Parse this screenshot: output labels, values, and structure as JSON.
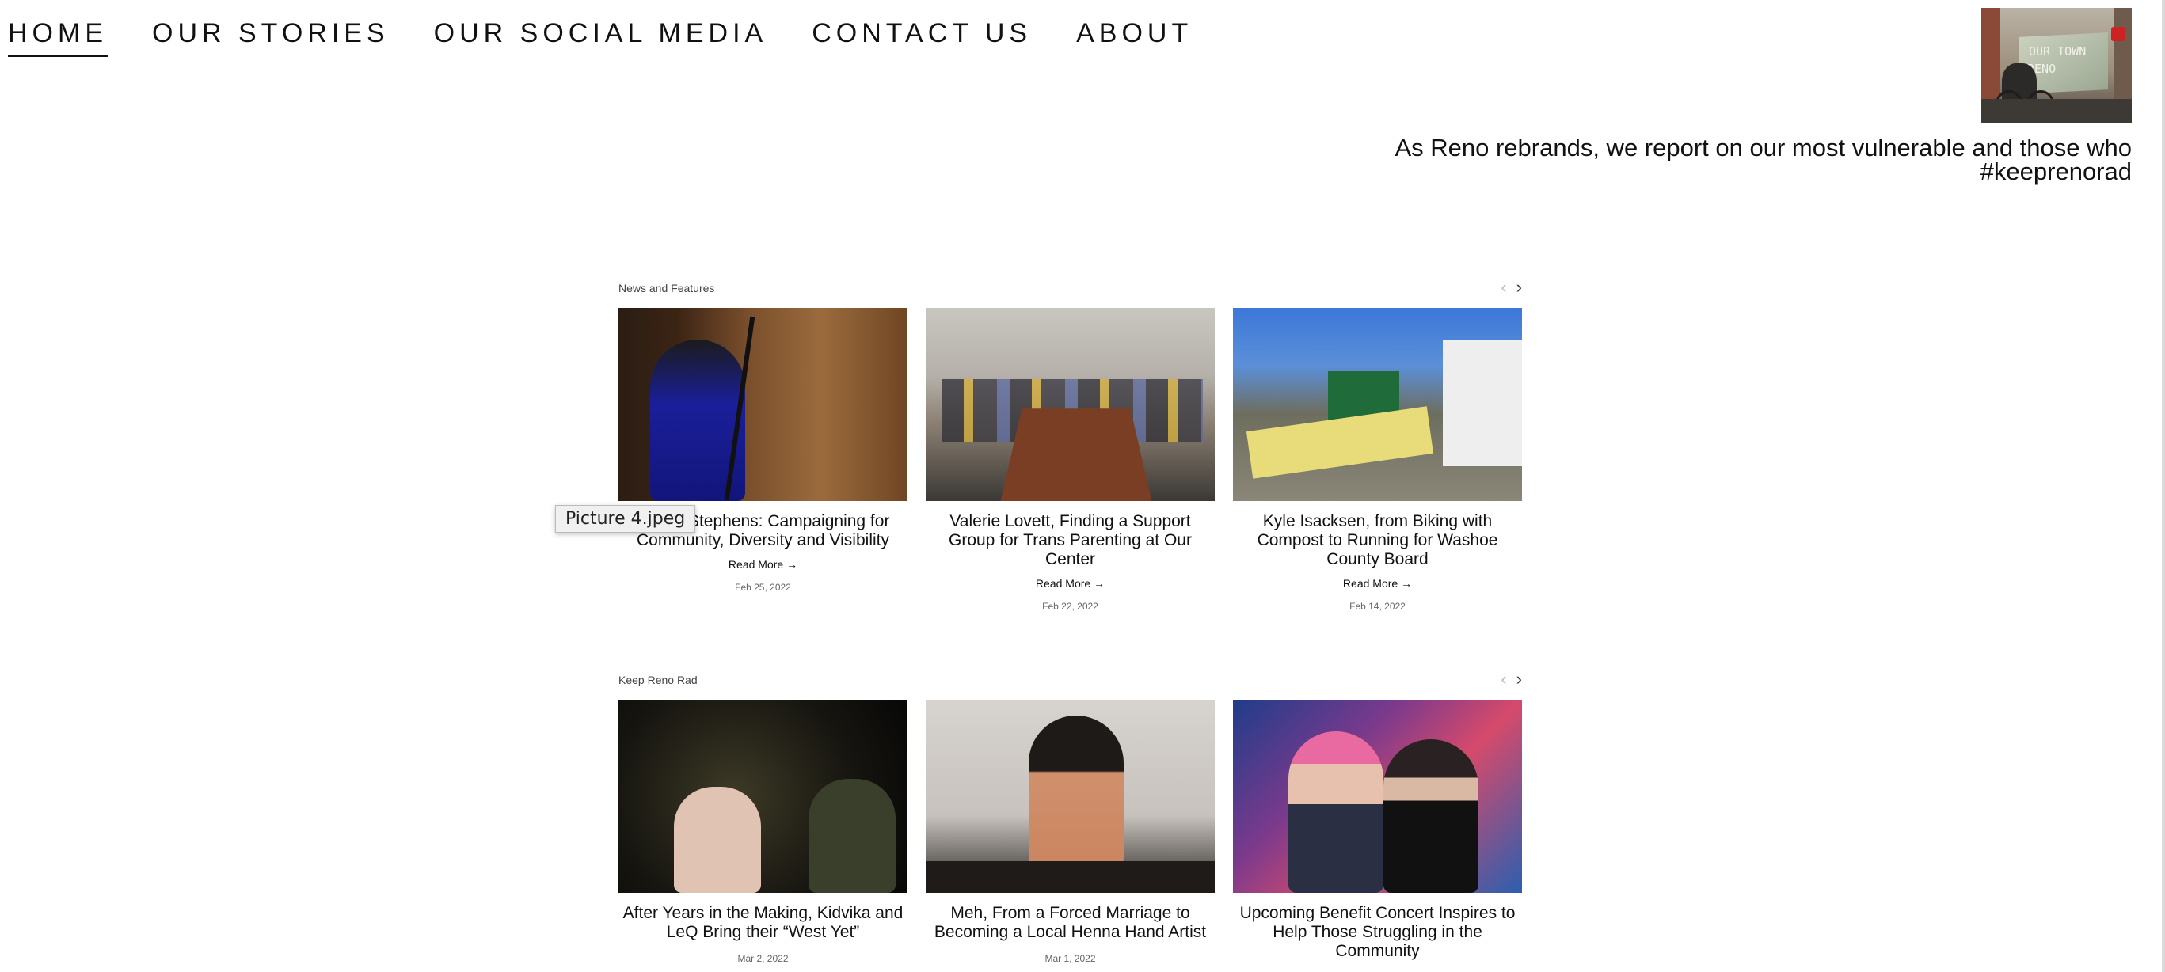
{
  "nav": {
    "items": [
      {
        "label": "HOME",
        "active": true
      },
      {
        "label": "OUR STORIES"
      },
      {
        "label": "OUR SOCIAL MEDIA"
      },
      {
        "label": "CONTACT US"
      },
      {
        "label": "ABOUT"
      }
    ]
  },
  "logo": {
    "sign_text_line1": "OUR TOWN",
    "sign_text_line2": "RENO"
  },
  "tagline": {
    "line1": "As Reno rebrands, we report on our most vulnerable and those who",
    "line2": "#keeprenorad"
  },
  "sections": [
    {
      "title": "News and Features",
      "prev_icon": "chevron-left-icon",
      "next_icon": "chevron-right-icon",
      "cards": [
        {
          "title": "Ebony Stephens: Campaigning for Community, Diversity and Visibility",
          "read_more": "Read More →",
          "date": "Feb 25, 2022"
        },
        {
          "title": "Valerie Lovett, Finding a Support Group for Trans Parenting at Our Center",
          "read_more": "Read More →",
          "date": "Feb 22, 2022"
        },
        {
          "title": "Kyle Isacksen, from Biking with Compost to Running for Washoe County Board",
          "read_more": "Read More →",
          "date": "Feb 14, 2022"
        }
      ]
    },
    {
      "title": "Keep Reno Rad",
      "prev_icon": "chevron-left-icon",
      "next_icon": "chevron-right-icon",
      "cards": [
        {
          "title": "After Years in the Making, Kidvika and LeQ Bring their “West Yet”",
          "date": "Mar 2, 2022"
        },
        {
          "title": "Meh, From a Forced Marriage to Becoming a Local Henna Hand Artist",
          "date": "Mar 1, 2022"
        },
        {
          "title": "Upcoming Benefit Concert Inspires to Help Those Struggling in the Community",
          "date": ""
        }
      ]
    }
  ],
  "tooltip": {
    "text": "Picture 4.jpeg"
  }
}
